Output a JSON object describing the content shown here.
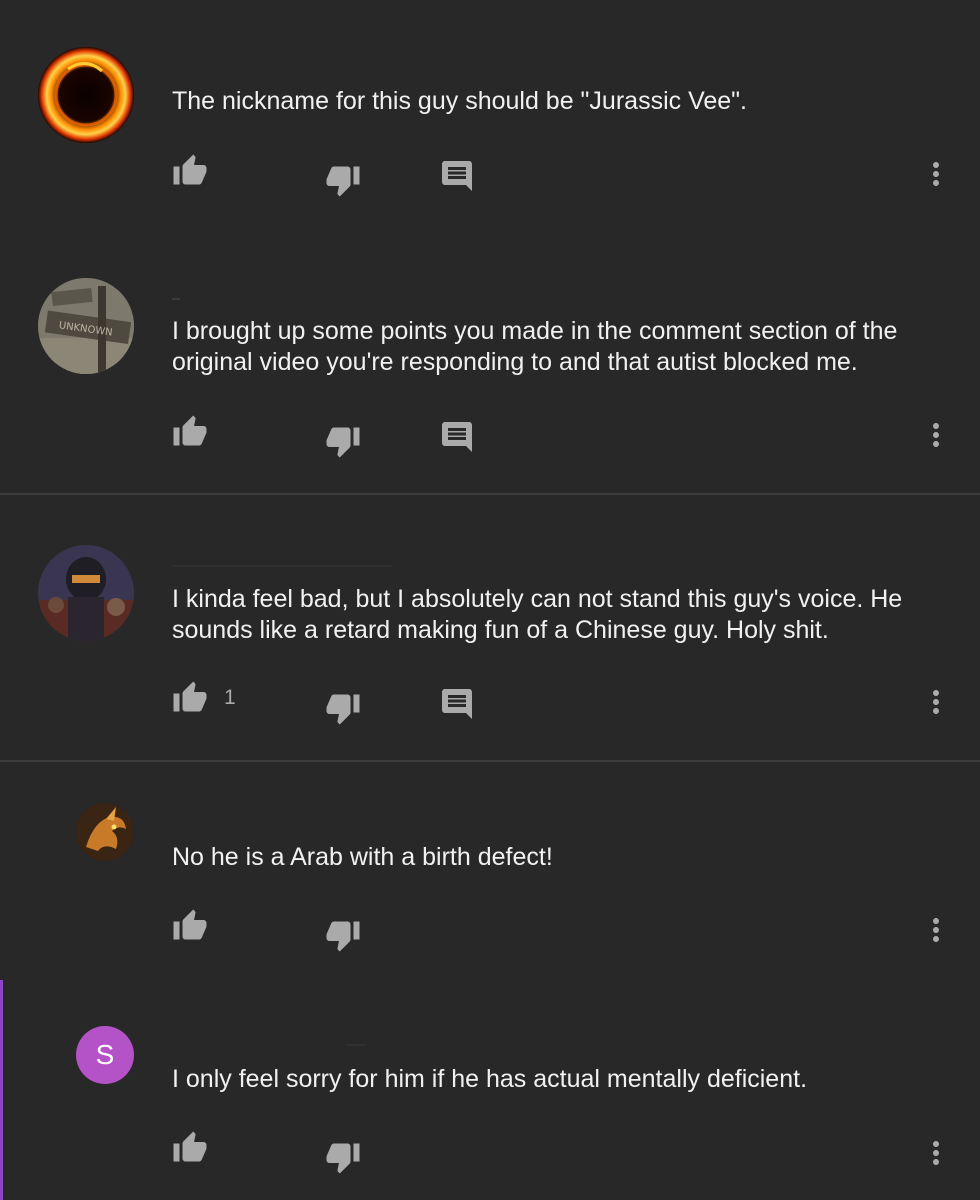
{
  "comments": [
    {
      "avatar": "fire-dragon-ring-avatar",
      "text": "The nickname for this guy should be \"Jurassic Vee\".",
      "like_count": "",
      "has_reply": true
    },
    {
      "avatar": "unknown-sign-avatar",
      "text": "I brought up some points you made in the comment section of the original video you're responding to and that autist blocked me.",
      "like_count": "",
      "has_reply": true
    },
    {
      "avatar": "soldier-helmet-avatar",
      "text": "I kinda feel bad, but I absolutely can not stand this guy's voice. He sounds like a retard making fun of a Chinese guy. Holy shit.",
      "like_count": "1",
      "has_reply": true
    },
    {
      "avatar": "dragon-avatar",
      "text": "No he is a Arab with a birth defect!",
      "like_count": "",
      "has_reply": false
    },
    {
      "avatar": "letter-avatar",
      "avatar_letter": "S",
      "avatar_color": "#b452c7",
      "text": "I only feel sorry for him if he has actual mentally deficient.",
      "like_count": "",
      "has_reply": false
    }
  ],
  "icons": {
    "like": "thumbs-up-icon",
    "dislike": "thumbs-down-icon",
    "reply": "comment-icon",
    "more": "more-vert-icon"
  },
  "colors": {
    "background": "#282828",
    "text": "#f1f1f1",
    "icon": "#aaaaaa",
    "highlight": "#8e44c9"
  }
}
